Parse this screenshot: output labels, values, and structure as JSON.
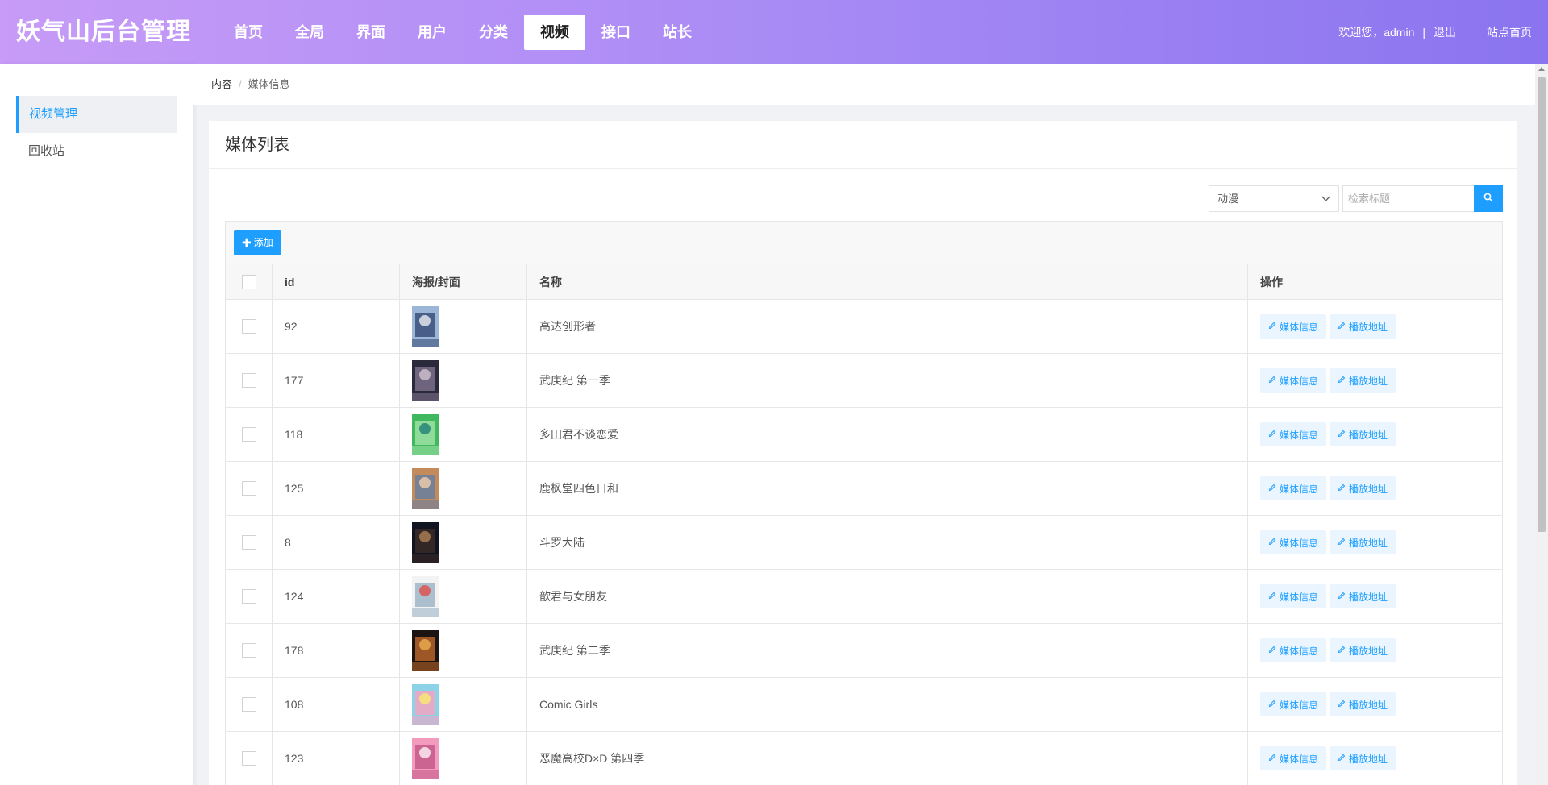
{
  "header": {
    "brand": "妖气山后台管理",
    "nav": [
      "首页",
      "全局",
      "界面",
      "用户",
      "分类",
      "视频",
      "接口",
      "站长"
    ],
    "active_nav_index": 5,
    "welcome": "欢迎您，admin",
    "separator": "|",
    "logout": "退出",
    "site_home": "站点首页"
  },
  "sidebar": {
    "items": [
      {
        "label": "视频管理",
        "active": true
      },
      {
        "label": "回收站",
        "active": false
      }
    ]
  },
  "breadcrumb": {
    "root": "内容",
    "divider": "/",
    "current": "媒体信息"
  },
  "card": {
    "title": "媒体列表",
    "category_select": "动漫",
    "search_placeholder": "检索标题",
    "add_label": "添加",
    "add_symbol": "✚"
  },
  "table": {
    "headers": [
      "id",
      "海报/封面",
      "名称",
      "操作"
    ],
    "action_labels": [
      "媒体信息",
      "播放地址"
    ],
    "rows": [
      {
        "id": "92",
        "name": "高达创形者",
        "poster_colors": [
          "#9bb6d6",
          "#3b4f7a",
          "#d7dbe6"
        ]
      },
      {
        "id": "177",
        "name": "武庚纪 第一季",
        "poster_colors": [
          "#2b2a3a",
          "#7a6f8a",
          "#c8b8c6"
        ]
      },
      {
        "id": "118",
        "name": "多田君不谈恋爱",
        "poster_colors": [
          "#3fb85e",
          "#9de0a4",
          "#2c8a7a"
        ]
      },
      {
        "id": "125",
        "name": "鹿枫堂四色日和",
        "poster_colors": [
          "#c38a5c",
          "#6a7fa0",
          "#e3c5a8"
        ]
      },
      {
        "id": "8",
        "name": "斗罗大陆",
        "poster_colors": [
          "#0f1420",
          "#3a2a28",
          "#a07850"
        ]
      },
      {
        "id": "124",
        "name": "歆君与女朋友",
        "poster_colors": [
          "#f3f3f3",
          "#9fb5c8",
          "#d95a5a"
        ]
      },
      {
        "id": "178",
        "name": "武庚纪 第二季",
        "poster_colors": [
          "#1c1410",
          "#b4622a",
          "#e7a44c"
        ]
      },
      {
        "id": "108",
        "name": "Comic Girls",
        "poster_colors": [
          "#8dd3e8",
          "#f2a3bf",
          "#f7e27a"
        ]
      },
      {
        "id": "123",
        "name": "恶魔高校D×D 第四季",
        "poster_colors": [
          "#f29bbd",
          "#c55a8a",
          "#f8e2ec"
        ]
      }
    ]
  }
}
